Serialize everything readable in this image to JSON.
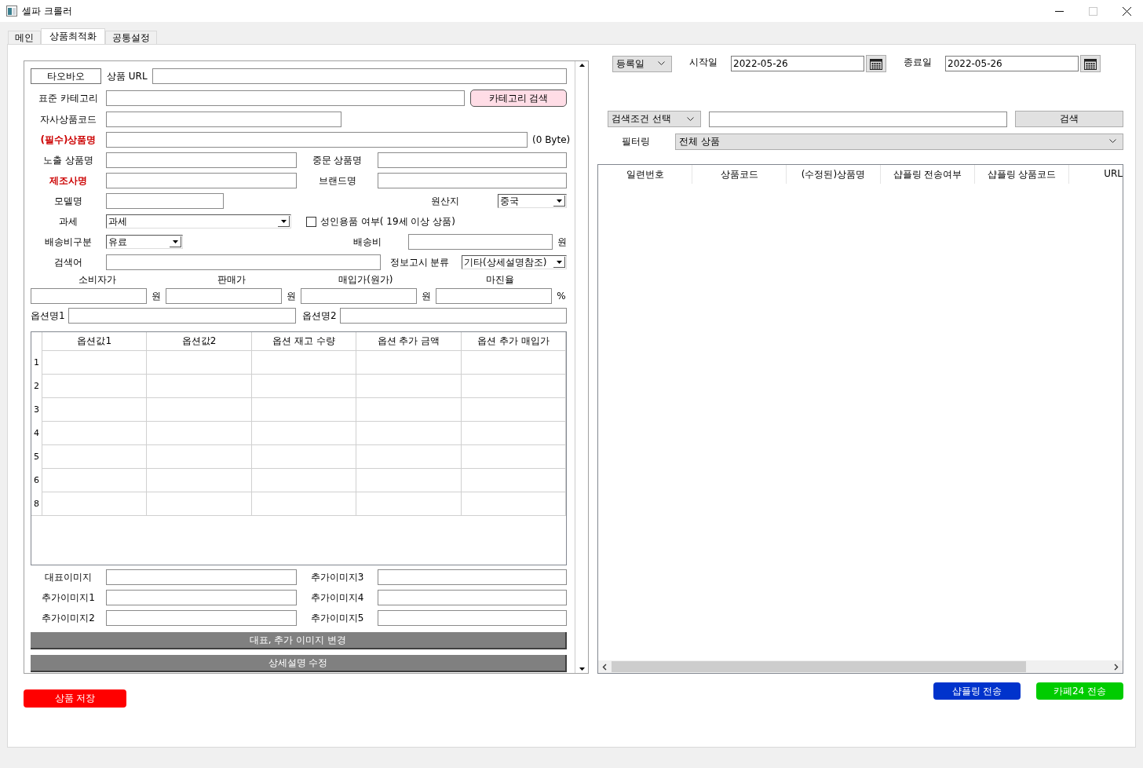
{
  "window": {
    "title": "셀파 크롤러"
  },
  "tabs": [
    {
      "label": "메인",
      "selected": false
    },
    {
      "label": "상품최적화",
      "selected": true
    },
    {
      "label": "공통설정",
      "selected": false
    }
  ],
  "product_form": {
    "source_button": "타오바오",
    "url": {
      "label": "상품 URL"
    },
    "category": {
      "label": "표준 카테고리",
      "button": "카테고리 검색"
    },
    "own_code": {
      "label": "자사상품코드"
    },
    "product_name": {
      "label": "(필수)상품명",
      "required": true,
      "byte_count": "(0 Byte)"
    },
    "display_name": {
      "label": "노출 상품명",
      "required": false
    },
    "chinese_name": {
      "label": "중문 상품명"
    },
    "manufacturer": {
      "label": "제조사명",
      "required": true
    },
    "brand": {
      "label": "브랜드명"
    },
    "model": {
      "label": "모델명"
    },
    "origin": {
      "label": "원산지",
      "value": "중국"
    },
    "tax": {
      "label": "과세",
      "value": "과세"
    },
    "adult": {
      "label": "성인용품 여부( 19세 이상 상품)",
      "checked": false
    },
    "shipping_type": {
      "label": "배송비구분",
      "value": "유료"
    },
    "shipping_fee": {
      "label": "배송비",
      "unit": "원"
    },
    "keywords": {
      "label": "검색어"
    },
    "notice_class": {
      "label": "정보고시 분류",
      "value": "기타(상세설명참조)"
    },
    "prices": [
      {
        "label": "소비자가",
        "unit": "원"
      },
      {
        "label": "판매가",
        "unit": "원"
      },
      {
        "label": "매입가(원가)",
        "unit": "원"
      },
      {
        "label": "마진율",
        "unit": "%"
      }
    ],
    "option_names": [
      {
        "label": "옵션명1"
      },
      {
        "label": "옵션명2"
      }
    ],
    "option_table": {
      "columns": [
        "옵션값1",
        "옵션값2",
        "옵션 재고 수량",
        "옵션 추가 금액",
        "옵션 추가 매입가"
      ],
      "rows": [
        "1",
        "2",
        "3",
        "4",
        "5",
        "6",
        "8"
      ]
    },
    "images": [
      {
        "label": "대표이미지"
      },
      {
        "label": "추가이미지3"
      },
      {
        "label": "추가이미지1"
      },
      {
        "label": "추가이미지4"
      },
      {
        "label": "추가이미지2"
      },
      {
        "label": "추가이미지5"
      }
    ],
    "action_buttons": [
      "대표, 추가 이미지 변경",
      "상세설명 수정"
    ]
  },
  "save_button": "상품 저장",
  "search_panel": {
    "date_type": "등록일",
    "start": {
      "label": "시작일",
      "value": "2022-05-26"
    },
    "end": {
      "label": "종료일",
      "value": "2022-05-26"
    },
    "condition": "검색조건 선택",
    "search_button": "검색",
    "filter": {
      "label": "필터링",
      "value": "전체 상품"
    }
  },
  "result_table": {
    "columns": [
      "일련번호",
      "상품코드",
      "(수정된)상품명",
      "샵플링 전송여부",
      "샵플링 상품코드",
      "URL"
    ]
  },
  "send_buttons": [
    {
      "label": "샵플링 전송",
      "color": "#0033cc"
    },
    {
      "label": "카페24 전송",
      "color": "#00cc00"
    }
  ]
}
